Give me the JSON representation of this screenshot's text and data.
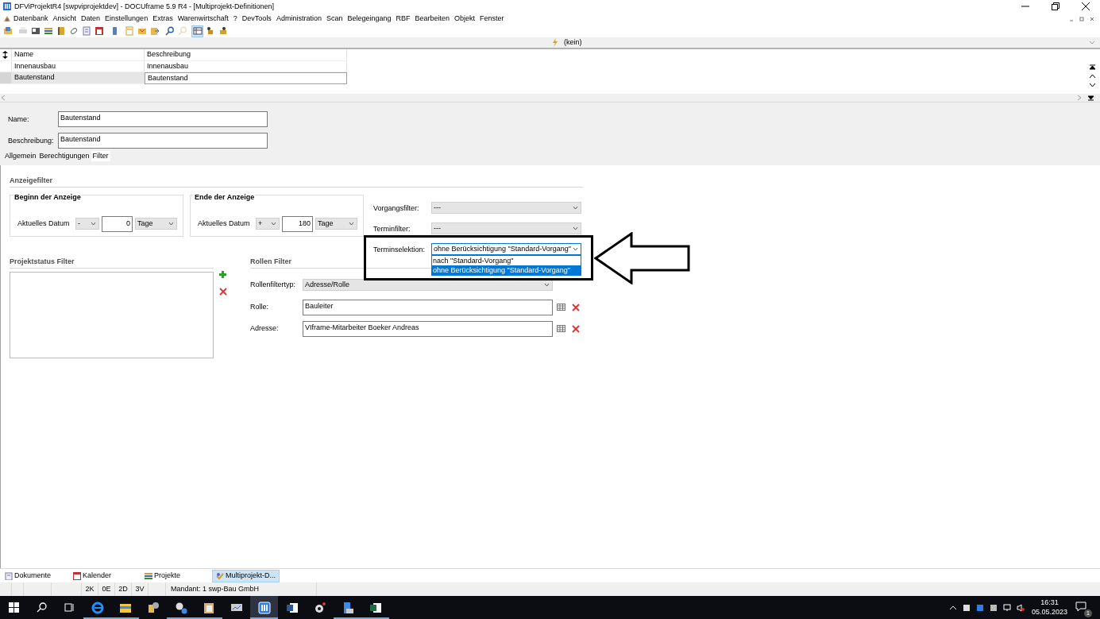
{
  "window": {
    "title": "DFViProjektR4 [swpviprojektdev] - DOCUframe 5.9 R4 - [Multiprojekt-Definitionen]"
  },
  "menu": [
    "Datenbank",
    "Ansicht",
    "Daten",
    "Einstellungen",
    "Extras",
    "Warenwirtschaft",
    "?",
    "DevTools",
    "Administration",
    "Scan",
    "Belegeingang",
    "RBF",
    "Bearbeiten",
    "Objekt",
    "Fenster"
  ],
  "toolbar": [
    {
      "disabled": false,
      "selected": false
    },
    {
      "disabled": true,
      "selected": false
    },
    {
      "disabled": false,
      "selected": false
    },
    {
      "disabled": false,
      "selected": false
    },
    {
      "disabled": false,
      "selected": false
    },
    {
      "disabled": false,
      "selected": false
    },
    {
      "disabled": false,
      "selected": false
    },
    {
      "disabled": false,
      "selected": false
    },
    {
      "disabled": false,
      "selected": false
    },
    {
      "disabled": false,
      "selected": false
    },
    {
      "disabled": false,
      "selected": false
    },
    {
      "disabled": false,
      "selected": false
    },
    {
      "disabled": false,
      "selected": false
    },
    {
      "disabled": true,
      "selected": false
    },
    {
      "disabled": false,
      "selected": true
    },
    {
      "disabled": false,
      "selected": false
    },
    {
      "disabled": false,
      "selected": false
    }
  ],
  "filter_bar": {
    "value": "(kein)"
  },
  "grid": {
    "columns": [
      "Name",
      "Beschreibung"
    ],
    "rows": [
      {
        "cells": [
          "Innenausbau",
          "Innenausbau"
        ],
        "selected": false
      },
      {
        "cells": [
          "Bautenstand",
          "Bautenstand"
        ],
        "selected": true
      }
    ]
  },
  "form": {
    "fields": [
      {
        "label": "Name:",
        "value": "Bautenstand"
      },
      {
        "label": "Beschreibung:",
        "value": "Bautenstand"
      }
    ]
  },
  "tabs": [
    {
      "label": "Allgemein",
      "selected": false
    },
    {
      "label": "Berechtigungen",
      "selected": false
    },
    {
      "label": "Filter",
      "selected": true
    }
  ],
  "anzeigefilter": {
    "title": "Anzeigefilter",
    "groups": [
      {
        "title": "Beginn der Anzeige",
        "label": "Aktuelles Datum",
        "sign": "-",
        "amount": "0",
        "unit": "Tage"
      },
      {
        "title": "Ende der Anzeige",
        "label": "Aktuelles Datum",
        "sign": "+",
        "amount": "180",
        "unit": "Tage"
      }
    ],
    "selects": [
      {
        "label": "Vorgangsfilter:",
        "value": "---",
        "expanded": false
      },
      {
        "label": "Terminfilter:",
        "value": "---",
        "expanded": false
      },
      {
        "label": "Terminselektion:",
        "value": "ohne Berücksichtigung \"Standard-Vorgang\"",
        "expanded": true,
        "options": [
          {
            "label": "nach \"Standard-Vorgang\"",
            "selected": false
          },
          {
            "label": "ohne Berücksichtigung \"Standard-Vorgang\"",
            "selected": true
          }
        ]
      }
    ]
  },
  "projektstatus": {
    "title": "Projektstatus Filter"
  },
  "rollen": {
    "title": "Rollen Filter",
    "type": {
      "label": "Rollenfiltertyp:",
      "value": "Adresse/Rolle"
    },
    "fields": [
      {
        "label": "Rolle:",
        "value": "Bauleiter"
      },
      {
        "label": "Adresse:",
        "value": "VIframe-Mitarbeiter Boeker Andreas"
      }
    ]
  },
  "bottom_tabs": [
    {
      "label": "Dokumente",
      "selected": false
    },
    {
      "label": "Kalender",
      "selected": false
    },
    {
      "label": "Projekte",
      "selected": false
    },
    {
      "label": "Multiprojekt-D...",
      "selected": true
    }
  ],
  "status_bar": {
    "counters": [
      "2K",
      "0E",
      "2D",
      "3V"
    ],
    "mandant": "Mandant: 1 swp-Bau GmbH"
  },
  "taskbar": {
    "apps": [
      {
        "running": true,
        "selected": false
      },
      {
        "running": true,
        "selected": false
      },
      {
        "running": false,
        "selected": false
      },
      {
        "running": true,
        "selected": false
      },
      {
        "running": true,
        "selected": false
      },
      {
        "running": false,
        "selected": false
      },
      {
        "running": true,
        "selected": true
      },
      {
        "running": false,
        "selected": false
      },
      {
        "running": false,
        "selected": false
      },
      {
        "running": true,
        "selected": false
      },
      {
        "running": true,
        "selected": false
      }
    ],
    "time": "16:31",
    "date": "05.05.2023",
    "notifications": "1"
  }
}
